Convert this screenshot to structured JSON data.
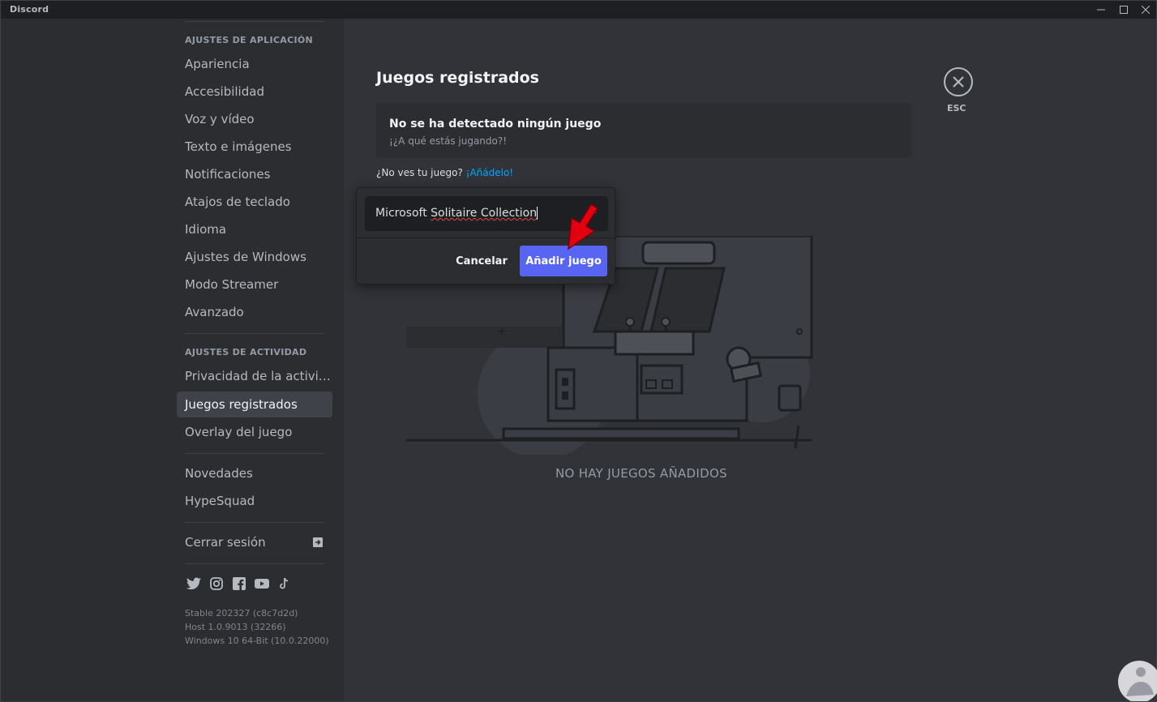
{
  "titlebar": {
    "title": "Discord"
  },
  "sidebar": {
    "app_settings_header": "AJUSTES DE APLICACIÓN",
    "app_settings_items": [
      {
        "label": "Apariencia"
      },
      {
        "label": "Accesibilidad"
      },
      {
        "label": "Voz y vídeo"
      },
      {
        "label": "Texto e imágenes"
      },
      {
        "label": "Notificaciones"
      },
      {
        "label": "Atajos de teclado"
      },
      {
        "label": "Idioma"
      },
      {
        "label": "Ajustes de Windows"
      },
      {
        "label": "Modo Streamer"
      },
      {
        "label": "Avanzado"
      }
    ],
    "activity_settings_header": "AJUSTES DE ACTIVIDAD",
    "activity_items": [
      {
        "label": "Privacidad de la actividad"
      },
      {
        "label": "Juegos registrados"
      },
      {
        "label": "Overlay del juego"
      }
    ],
    "misc_items": [
      {
        "label": "Novedades"
      },
      {
        "label": "HypeSquad"
      }
    ],
    "logout_label": "Cerrar sesión",
    "social_icons": [
      "twitter-icon",
      "instagram-icon",
      "facebook-icon",
      "youtube-icon",
      "tiktok-icon"
    ],
    "version_lines": [
      "Stable 202327 (c8c7d2d)",
      "Host 1.0.9013 (32266)",
      "Windows 10 64-Bit (10.0.22000)"
    ]
  },
  "main": {
    "title": "Juegos registrados",
    "no_game_title": "No se ha detectado ningún juego",
    "no_game_subtitle": "¡¿A qué estás jugando?!",
    "not_see_text": "¿No ves tu juego? ",
    "add_link": "¡Añádelo!",
    "esc_label": "ESC",
    "empty_text": "NO HAY JUEGOS AÑADIDOS"
  },
  "popup": {
    "input_value_part1": "Microsoft ",
    "input_value_part2": "Solitaire Collection",
    "cancel_label": "Cancelar",
    "add_label": "Añadir juego"
  },
  "colors": {
    "accent": "#5865f2",
    "link": "#00a8fc",
    "sidebar_bg": "#2b2d31",
    "content_bg": "#313338",
    "annotation_arrow": "#e3000f"
  }
}
